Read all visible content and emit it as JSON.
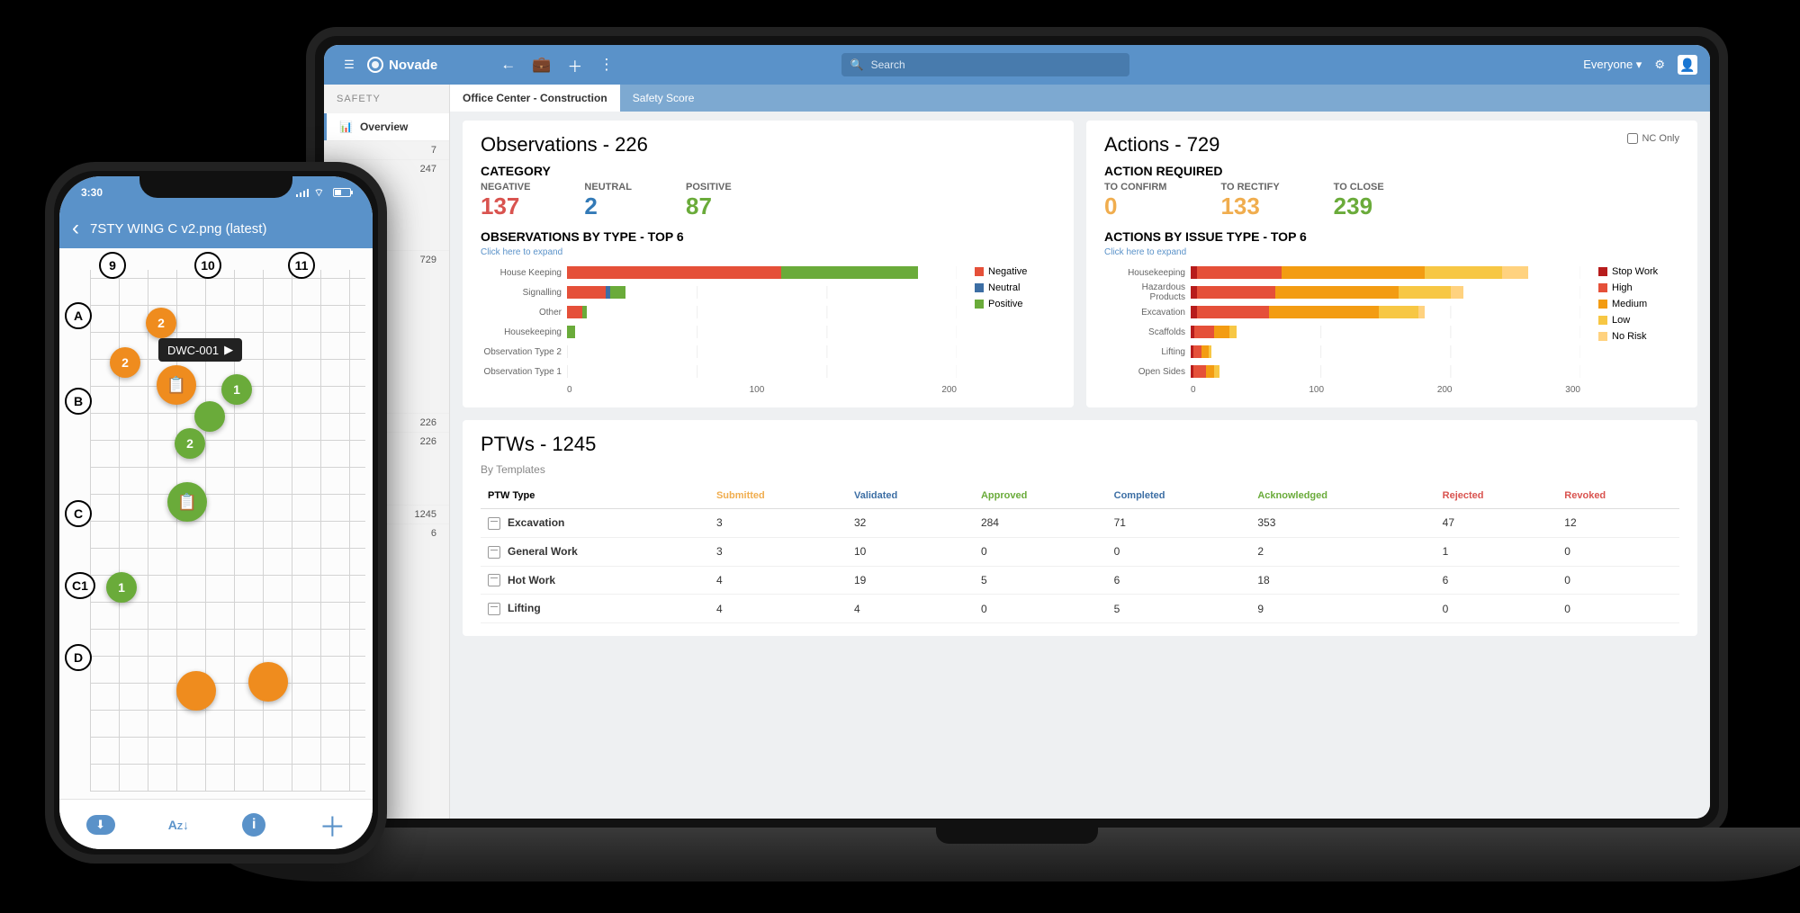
{
  "laptop": {
    "brand": "Novade",
    "search_placeholder": "Search",
    "user_scope": "Everyone",
    "sidebar": {
      "section": "SAFETY",
      "item": "Overview",
      "numbers": [
        "7",
        "247",
        "729",
        "226",
        "226",
        "1245",
        "6"
      ]
    },
    "tabs": {
      "active": "Office Center - Construction",
      "other": "Safety Score"
    },
    "observations": {
      "title": "Observations - 226",
      "category_label": "CATEGORY",
      "neg_label": "NEGATIVE",
      "neg": "137",
      "neu_label": "NEUTRAL",
      "neu": "2",
      "pos_label": "POSITIVE",
      "pos": "87",
      "chart_title": "OBSERVATIONS BY TYPE - TOP 6",
      "hint": "Click here to expand"
    },
    "actions": {
      "title": "Actions - 729",
      "nc_only": "NC Only",
      "req_label": "ACTION REQUIRED",
      "conf_label": "TO CONFIRM",
      "conf": "0",
      "rect_label": "TO RECTIFY",
      "rect": "133",
      "close_label": "TO CLOSE",
      "close": "239",
      "chart_title": "ACTIONS BY ISSUE TYPE - TOP 6",
      "hint": "Click here to expand"
    },
    "ptw": {
      "title": "PTWs - 1245",
      "sub": "By Templates",
      "headers": {
        "type": "PTW Type",
        "sub": "Submitted",
        "val": "Validated",
        "app": "Approved",
        "com": "Completed",
        "ack": "Acknowledged",
        "rej": "Rejected",
        "rev": "Revoked"
      },
      "rows": [
        {
          "type": "Excavation",
          "sub": "3",
          "val": "32",
          "app": "284",
          "com": "71",
          "ack": "353",
          "rej": "47",
          "rev": "12"
        },
        {
          "type": "General Work",
          "sub": "3",
          "val": "10",
          "app": "0",
          "com": "0",
          "ack": "2",
          "rej": "1",
          "rev": "0"
        },
        {
          "type": "Hot Work",
          "sub": "4",
          "val": "19",
          "app": "5",
          "com": "6",
          "ack": "18",
          "rej": "6",
          "rev": "0"
        },
        {
          "type": "Lifting",
          "sub": "4",
          "val": "4",
          "app": "0",
          "com": "5",
          "ack": "9",
          "rej": "0",
          "rev": "0"
        }
      ]
    },
    "legends": {
      "obs": [
        "Negative",
        "Neutral",
        "Positive"
      ],
      "act": [
        "Stop Work",
        "High",
        "Medium",
        "Low",
        "No Risk"
      ]
    },
    "axis": {
      "obs": [
        "0",
        "100",
        "200"
      ],
      "act": [
        "0",
        "100",
        "200",
        "300"
      ]
    }
  },
  "phone": {
    "time": "3:30",
    "title": "7STY WING C v2.png (latest)",
    "cols": [
      "9",
      "10",
      "11"
    ],
    "rows": [
      "A",
      "B",
      "C",
      "C1",
      "D"
    ],
    "callout": "DWC-001"
  },
  "chart_data": [
    {
      "type": "bar",
      "orientation": "horizontal",
      "stacked": true,
      "title": "OBSERVATIONS BY TYPE - TOP 6",
      "xlabel": "",
      "ylabel": "",
      "xlim": [
        0,
        200
      ],
      "categories": [
        "House Keeping",
        "Signalling",
        "Other",
        "Housekeeping",
        "Observation Type 2",
        "Observation Type 1"
      ],
      "series": [
        {
          "name": "Negative",
          "color": "#e55039",
          "values": [
            110,
            20,
            8,
            0,
            0,
            0
          ]
        },
        {
          "name": "Neutral",
          "color": "#3c6ea4",
          "values": [
            0,
            2,
            0,
            0,
            0,
            0
          ]
        },
        {
          "name": "Positive",
          "color": "#6aab3a",
          "values": [
            70,
            8,
            2,
            4,
            0,
            0
          ]
        }
      ]
    },
    {
      "type": "bar",
      "orientation": "horizontal",
      "stacked": true,
      "title": "ACTIONS BY ISSUE TYPE - TOP 6",
      "xlabel": "",
      "ylabel": "",
      "xlim": [
        0,
        300
      ],
      "categories": [
        "Housekeeping",
        "Hazardous Products",
        "Excavation",
        "Scaffolds",
        "Lifting",
        "Open Sides"
      ],
      "series": [
        {
          "name": "Stop Work",
          "color": "#b71c1c",
          "values": [
            5,
            5,
            5,
            3,
            2,
            2
          ]
        },
        {
          "name": "High",
          "color": "#e55039",
          "values": [
            65,
            60,
            55,
            15,
            6,
            10
          ]
        },
        {
          "name": "Medium",
          "color": "#f39c12",
          "values": [
            110,
            95,
            85,
            12,
            6,
            6
          ]
        },
        {
          "name": "Low",
          "color": "#f7c744",
          "values": [
            60,
            40,
            30,
            5,
            2,
            4
          ]
        },
        {
          "name": "No Risk",
          "color": "#ffd27f",
          "values": [
            20,
            10,
            5,
            0,
            0,
            0
          ]
        }
      ]
    }
  ]
}
